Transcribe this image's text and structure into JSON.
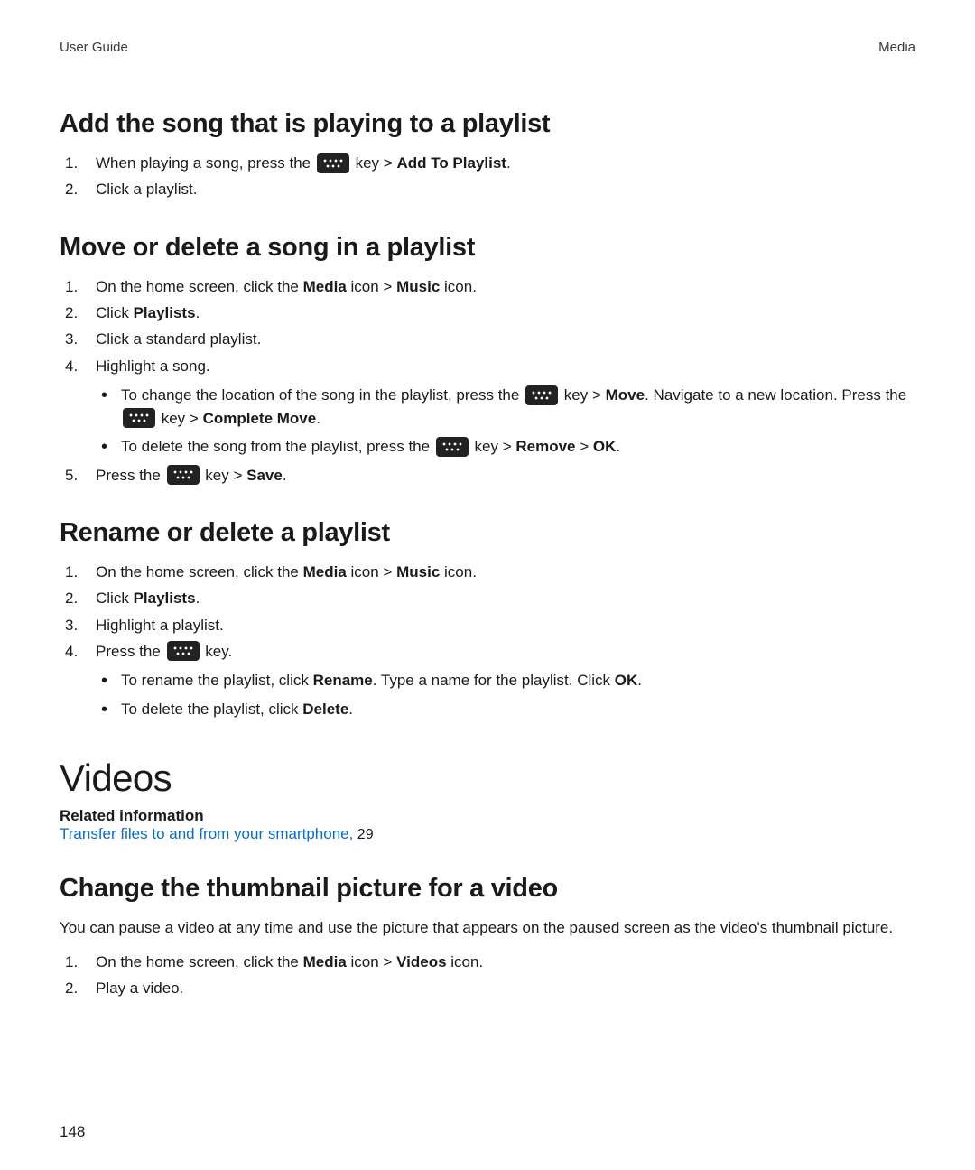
{
  "header": {
    "left": "User Guide",
    "right": "Media"
  },
  "page_number": "148",
  "s1": {
    "title": "Add the song that is playing to a playlist",
    "step1_a": "When playing a song, press the ",
    "step1_b": " key > ",
    "step1_bold": "Add To Playlist",
    "step1_c": ".",
    "step2": "Click a playlist."
  },
  "s2": {
    "title": "Move or delete a song in a playlist",
    "step1_a": "On the home screen, click the ",
    "step1_b1": "Media",
    "step1_c": " icon > ",
    "step1_b2": "Music",
    "step1_d": " icon.",
    "step2_a": "Click ",
    "step2_b": "Playlists",
    "step2_c": ".",
    "step3": "Click a standard playlist.",
    "step4": "Highlight a song.",
    "sub1_a": "To change the location of the song in the playlist, press the ",
    "sub1_b": " key > ",
    "sub1_bold1": "Move",
    "sub1_c": ". Navigate to a new location. Press the ",
    "sub1_d": " key > ",
    "sub1_bold2": "Complete Move",
    "sub1_e": ".",
    "sub2_a": "To delete the song from the playlist, press the ",
    "sub2_b": " key > ",
    "sub2_bold1": "Remove",
    "sub2_c": " > ",
    "sub2_bold2": "OK",
    "sub2_d": ".",
    "step5_a": "Press the ",
    "step5_b": " key > ",
    "step5_bold": "Save",
    "step5_c": "."
  },
  "s3": {
    "title": "Rename or delete a playlist",
    "step1_a": "On the home screen, click the ",
    "step1_b1": "Media",
    "step1_c": " icon > ",
    "step1_b2": "Music",
    "step1_d": " icon.",
    "step2_a": "Click ",
    "step2_b": "Playlists",
    "step2_c": ".",
    "step3": "Highlight a playlist.",
    "step4_a": "Press the ",
    "step4_b": " key.",
    "sub1_a": "To rename the playlist, click ",
    "sub1_bold1": "Rename",
    "sub1_b": ". Type a name for the playlist. Click ",
    "sub1_bold2": "OK",
    "sub1_c": ".",
    "sub2_a": "To delete the playlist, click ",
    "sub2_bold": "Delete",
    "sub2_b": "."
  },
  "videos": {
    "title": "Videos",
    "related_label": "Related information",
    "link_text": "Transfer files to and from your smartphone,",
    "link_page": " 29"
  },
  "s4": {
    "title": "Change the thumbnail picture for a video",
    "intro": "You can pause a video at any time and use the picture that appears on the paused screen as the video's thumbnail picture.",
    "step1_a": "On the home screen, click the ",
    "step1_b1": "Media",
    "step1_c": " icon > ",
    "step1_b2": "Videos",
    "step1_d": " icon.",
    "step2": "Play a video."
  }
}
